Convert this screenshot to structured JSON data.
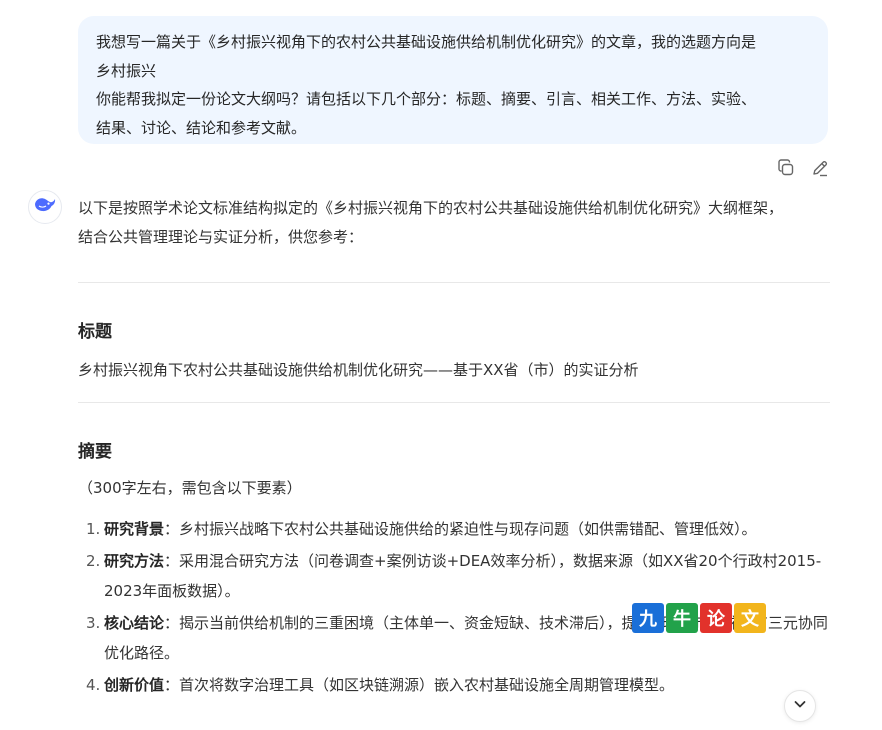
{
  "user_message": {
    "line1": "我想写一篇关于《乡村振兴视角下的农村公共基础设施供给机制优化研究》的文章，我的选题方向是",
    "line2": "乡村振兴",
    "line3": "你能帮我拟定一份论文大纲吗？请包括以下几个部分：标题、摘要、引言、相关工作、方法、实验、",
    "line4": "结果、讨论、结论和参考文献。"
  },
  "answer": {
    "intro_line1": "以下是按照学术论文标准结构拟定的《乡村振兴视角下的农村公共基础设施供给机制优化研究》大纲框架，",
    "intro_line2": "结合公共管理理论与实证分析，供您参考：",
    "title_heading": "标题",
    "title_text": "乡村振兴视角下农村公共基础设施供给机制优化研究——基于XX省（市）的实证分析",
    "abstract_heading": "摘要",
    "abstract_note": "（300字左右，需包含以下要素）",
    "points": [
      {
        "num": "1.",
        "label": "研究背景",
        "text": "：乡村振兴战略下农村公共基础设施供给的紧迫性与现存问题（如供需错配、管理低效）。"
      },
      {
        "num": "2.",
        "label": "研究方法",
        "text": "：采用混合研究方法（问卷调查+案例访谈+DEA效率分析），数据来源（如XX省20个行政村2015-2023年面板数据）。"
      },
      {
        "num": "3.",
        "label": "核心结论",
        "text": "：揭示当前供给机制的三重困境（主体单一、资金短缺、技术滞后），提出“政府-市场-社会”三元协同优化路径。"
      },
      {
        "num": "4.",
        "label": "创新价值",
        "text": "：首次将数字治理工具（如区块链溯源）嵌入农村基础设施全周期管理模型。"
      }
    ]
  },
  "watermark": {
    "chars": [
      "九",
      "牛",
      "论",
      "文"
    ],
    "colors": [
      "#1a6fd8",
      "#22a24a",
      "#e2322b",
      "#f2b51c"
    ]
  },
  "icons": {
    "copy": "copy-icon",
    "edit": "edit-icon",
    "avatar": "deepseek-whale-icon",
    "scroll": "chevron-down-icon"
  },
  "colors": {
    "bubble_bg": "#eff6ff",
    "avatar_blue": "#4d6bfe"
  }
}
